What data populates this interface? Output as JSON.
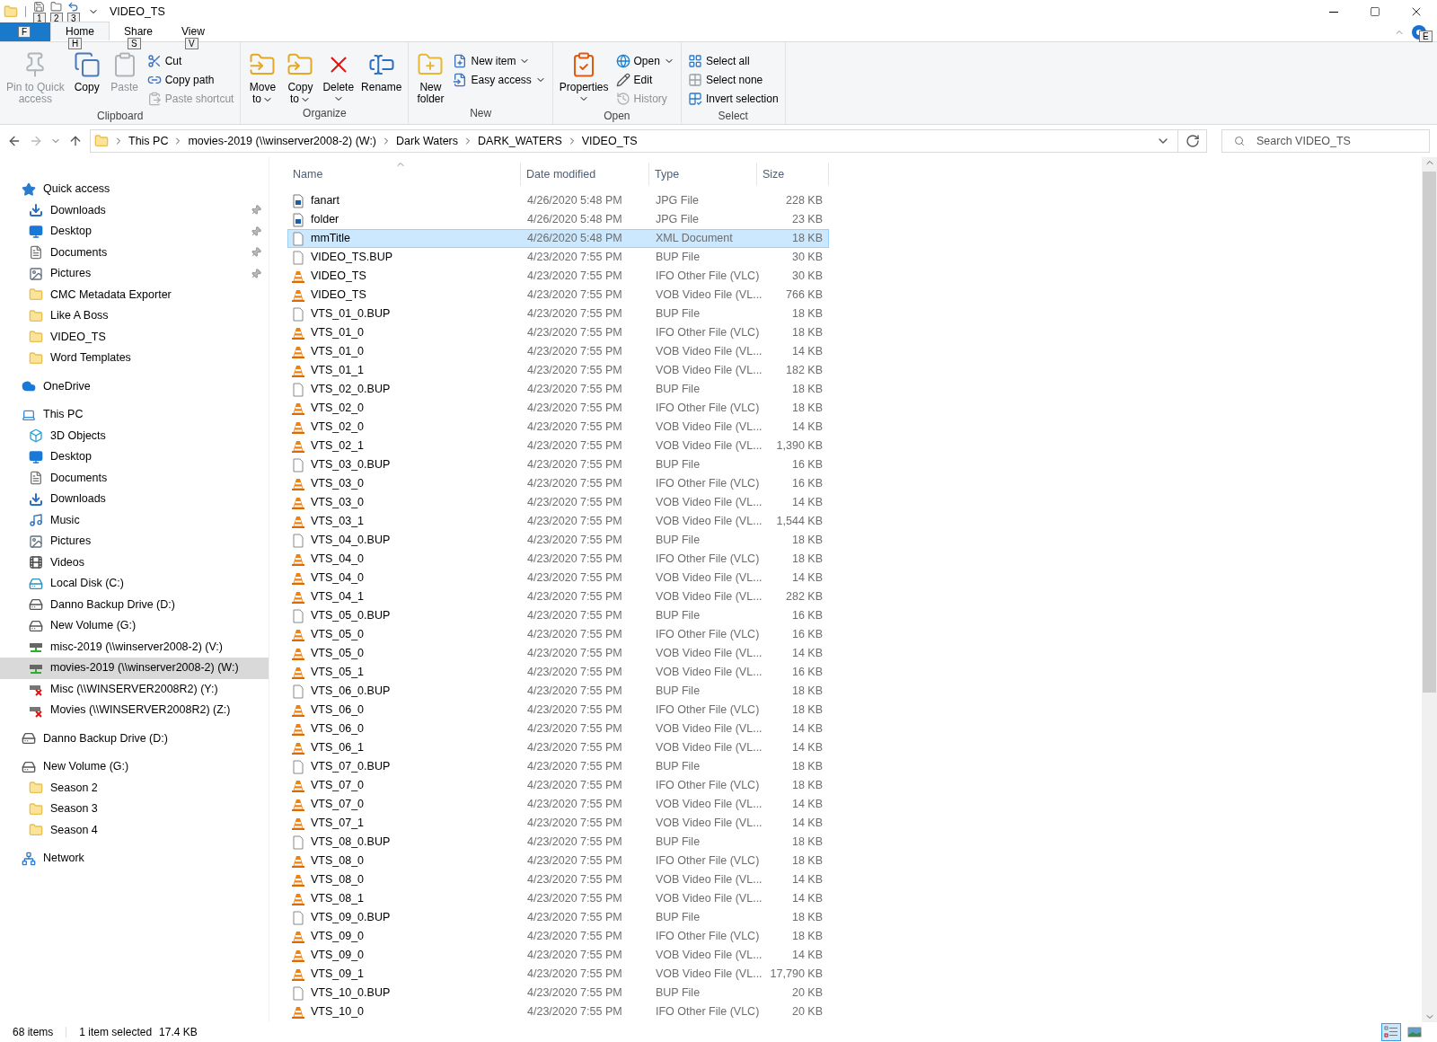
{
  "window": {
    "title": "VIDEO_TS"
  },
  "quick_access_toolbar": [
    {
      "key_tip": "1"
    },
    {
      "key_tip": "2"
    },
    {
      "key_tip": "3"
    }
  ],
  "tabs": [
    {
      "kind": "file",
      "key_tip": "F",
      "selected": false
    },
    {
      "kind": "tab",
      "label": "Home",
      "key_tip": "H",
      "selected": true
    },
    {
      "kind": "tab",
      "label": "Share",
      "key_tip": "S",
      "selected": false
    },
    {
      "kind": "tab",
      "label": "View",
      "key_tip": "V",
      "selected": false
    }
  ],
  "help": {
    "key_tip": "E"
  },
  "ribbon": [
    {
      "label": "Clipboard",
      "items": [
        {
          "kind": "large",
          "lines": [
            "Pin to Quick",
            "access"
          ],
          "disabled": true,
          "dropdown": false
        },
        {
          "kind": "large",
          "lines": [
            "Copy"
          ],
          "disabled": false,
          "dropdown": false
        },
        {
          "kind": "large",
          "lines": [
            "Paste"
          ],
          "disabled": true,
          "dropdown": false
        },
        {
          "kind": "small",
          "lines": [
            "Cut"
          ],
          "disabled": false,
          "dropdown": false
        },
        {
          "kind": "small",
          "lines": [
            "Copy path"
          ],
          "disabled": false,
          "dropdown": false
        },
        {
          "kind": "small",
          "lines": [
            "Paste shortcut"
          ],
          "disabled": true,
          "dropdown": false
        }
      ]
    },
    {
      "label": "Organize",
      "items": [
        {
          "kind": "large",
          "lines": [
            "Move",
            "to"
          ],
          "disabled": false,
          "dropdown": true
        },
        {
          "kind": "large",
          "lines": [
            "Copy",
            "to"
          ],
          "disabled": false,
          "dropdown": true
        },
        {
          "kind": "large",
          "lines": [
            "Delete"
          ],
          "disabled": false,
          "dropdown": true
        },
        {
          "kind": "large",
          "lines": [
            "Rename"
          ],
          "disabled": false,
          "dropdown": false
        }
      ]
    },
    {
      "label": "New",
      "items": [
        {
          "kind": "large",
          "lines": [
            "New",
            "folder"
          ],
          "disabled": false,
          "dropdown": false
        },
        {
          "kind": "small",
          "lines": [
            "New item"
          ],
          "disabled": false,
          "dropdown": true
        },
        {
          "kind": "small",
          "lines": [
            "Easy access"
          ],
          "disabled": false,
          "dropdown": true
        }
      ]
    },
    {
      "label": "Open",
      "items": [
        {
          "kind": "large",
          "lines": [
            "Properties"
          ],
          "disabled": false,
          "dropdown": true
        },
        {
          "kind": "small",
          "lines": [
            "Open"
          ],
          "disabled": false,
          "dropdown": true
        },
        {
          "kind": "small",
          "lines": [
            "Edit"
          ],
          "disabled": false,
          "dropdown": false
        },
        {
          "kind": "small",
          "lines": [
            "History"
          ],
          "disabled": true,
          "dropdown": false
        }
      ]
    },
    {
      "label": "Select",
      "items": [
        {
          "kind": "small",
          "lines": [
            "Select all"
          ],
          "disabled": false,
          "dropdown": false
        },
        {
          "kind": "small",
          "lines": [
            "Select none"
          ],
          "disabled": false,
          "dropdown": false
        },
        {
          "kind": "small",
          "lines": [
            "Invert selection"
          ],
          "disabled": false,
          "dropdown": false
        }
      ]
    }
  ],
  "address_bar": {
    "breadcrumbs": [
      "This PC",
      "movies-2019 (\\\\winserver2008-2) (W:)",
      "Dark Waters",
      "DARK_WATERS",
      "VIDEO_TS"
    ]
  },
  "search": {
    "placeholder": "Search VIDEO_TS"
  },
  "navigation": [
    {
      "label": "Quick access",
      "kind": "star",
      "selected": false,
      "children": [
        {
          "label": "Downloads",
          "kind": "download",
          "selected": false,
          "pinned": true
        },
        {
          "label": "Desktop",
          "kind": "desktop",
          "selected": false,
          "pinned": true
        },
        {
          "label": "Documents",
          "kind": "documents",
          "selected": false,
          "pinned": true
        },
        {
          "label": "Pictures",
          "kind": "pictures",
          "selected": false,
          "pinned": true
        },
        {
          "label": "CMC Metadata Exporter",
          "kind": "folder",
          "selected": false,
          "pinned": false
        },
        {
          "label": "Like A Boss",
          "kind": "folder",
          "selected": false,
          "pinned": false
        },
        {
          "label": "VIDEO_TS",
          "kind": "folder",
          "selected": false,
          "pinned": false
        },
        {
          "label": "Word Templates",
          "kind": "folder",
          "selected": false,
          "pinned": false
        }
      ]
    },
    {
      "label": "OneDrive",
      "kind": "cloud",
      "selected": false
    },
    {
      "label": "This PC",
      "kind": "pc",
      "selected": false,
      "children": [
        {
          "label": "3D Objects",
          "kind": "cube",
          "selected": false
        },
        {
          "label": "Desktop",
          "kind": "desktop",
          "selected": false
        },
        {
          "label": "Documents",
          "kind": "documents",
          "selected": false
        },
        {
          "label": "Downloads",
          "kind": "download",
          "selected": false
        },
        {
          "label": "Music",
          "kind": "music",
          "selected": false
        },
        {
          "label": "Pictures",
          "kind": "pictures",
          "selected": false
        },
        {
          "label": "Videos",
          "kind": "videos",
          "selected": false
        },
        {
          "label": "Local Disk (C:)",
          "kind": "system_disk",
          "selected": false
        },
        {
          "label": "Danno Backup Drive (D:)",
          "kind": "disk",
          "selected": false
        },
        {
          "label": "New Volume (G:)",
          "kind": "disk",
          "selected": false
        },
        {
          "label": "misc-2019 (\\\\winserver2008-2) (V:)",
          "kind": "net_drive",
          "selected": false
        },
        {
          "label": "movies-2019 (\\\\winserver2008-2) (W:)",
          "kind": "net_drive",
          "selected": true
        },
        {
          "label": "Misc (\\\\WINSERVER2008R2) (Y:)",
          "kind": "net_drive_off",
          "selected": false
        },
        {
          "label": "Movies (\\\\WINSERVER2008R2) (Z:)",
          "kind": "net_drive_off",
          "selected": false
        }
      ]
    },
    {
      "label": "Danno Backup Drive (D:)",
      "kind": "disk",
      "selected": false
    },
    {
      "label": "New Volume (G:)",
      "kind": "disk",
      "selected": false,
      "children": [
        {
          "label": "Season 2",
          "kind": "folder",
          "selected": false
        },
        {
          "label": "Season 3",
          "kind": "folder",
          "selected": false
        },
        {
          "label": "Season 4",
          "kind": "folder",
          "selected": false
        }
      ]
    },
    {
      "label": "Network",
      "kind": "network",
      "selected": false
    }
  ],
  "file_list": {
    "columns": [
      "Name",
      "Date modified",
      "Type",
      "Size"
    ],
    "rows": [
      {
        "name": "fanart",
        "date": "4/26/2020 5:48 PM",
        "type": "JPG File",
        "size": "228 KB",
        "kind": "image",
        "selected": false
      },
      {
        "name": "folder",
        "date": "4/26/2020 5:48 PM",
        "type": "JPG File",
        "size": "23 KB",
        "kind": "image",
        "selected": false
      },
      {
        "name": "mmTitle",
        "date": "4/26/2020 5:48 PM",
        "type": "XML Document",
        "size": "18 KB",
        "kind": "blank",
        "selected": true
      },
      {
        "name": "VIDEO_TS.BUP",
        "date": "4/23/2020 7:55 PM",
        "type": "BUP File",
        "size": "30 KB",
        "kind": "blank",
        "selected": false
      },
      {
        "name": "VIDEO_TS",
        "date": "4/23/2020 7:55 PM",
        "type": "IFO Other File (VLC)",
        "size": "30 KB",
        "kind": "vlc",
        "selected": false
      },
      {
        "name": "VIDEO_TS",
        "date": "4/23/2020 7:55 PM",
        "type": "VOB Video File (VL...",
        "size": "766 KB",
        "kind": "vlc",
        "selected": false
      },
      {
        "name": "VTS_01_0.BUP",
        "date": "4/23/2020 7:55 PM",
        "type": "BUP File",
        "size": "18 KB",
        "kind": "blank",
        "selected": false
      },
      {
        "name": "VTS_01_0",
        "date": "4/23/2020 7:55 PM",
        "type": "IFO Other File (VLC)",
        "size": "18 KB",
        "kind": "vlc",
        "selected": false
      },
      {
        "name": "VTS_01_0",
        "date": "4/23/2020 7:55 PM",
        "type": "VOB Video File (VL...",
        "size": "14 KB",
        "kind": "vlc",
        "selected": false
      },
      {
        "name": "VTS_01_1",
        "date": "4/23/2020 7:55 PM",
        "type": "VOB Video File (VL...",
        "size": "182 KB",
        "kind": "vlc",
        "selected": false
      },
      {
        "name": "VTS_02_0.BUP",
        "date": "4/23/2020 7:55 PM",
        "type": "BUP File",
        "size": "18 KB",
        "kind": "blank",
        "selected": false
      },
      {
        "name": "VTS_02_0",
        "date": "4/23/2020 7:55 PM",
        "type": "IFO Other File (VLC)",
        "size": "18 KB",
        "kind": "vlc",
        "selected": false
      },
      {
        "name": "VTS_02_0",
        "date": "4/23/2020 7:55 PM",
        "type": "VOB Video File (VL...",
        "size": "14 KB",
        "kind": "vlc",
        "selected": false
      },
      {
        "name": "VTS_02_1",
        "date": "4/23/2020 7:55 PM",
        "type": "VOB Video File (VL...",
        "size": "1,390 KB",
        "kind": "vlc",
        "selected": false
      },
      {
        "name": "VTS_03_0.BUP",
        "date": "4/23/2020 7:55 PM",
        "type": "BUP File",
        "size": "16 KB",
        "kind": "blank",
        "selected": false
      },
      {
        "name": "VTS_03_0",
        "date": "4/23/2020 7:55 PM",
        "type": "IFO Other File (VLC)",
        "size": "16 KB",
        "kind": "vlc",
        "selected": false
      },
      {
        "name": "VTS_03_0",
        "date": "4/23/2020 7:55 PM",
        "type": "VOB Video File (VL...",
        "size": "14 KB",
        "kind": "vlc",
        "selected": false
      },
      {
        "name": "VTS_03_1",
        "date": "4/23/2020 7:55 PM",
        "type": "VOB Video File (VL...",
        "size": "1,544 KB",
        "kind": "vlc",
        "selected": false
      },
      {
        "name": "VTS_04_0.BUP",
        "date": "4/23/2020 7:55 PM",
        "type": "BUP File",
        "size": "18 KB",
        "kind": "blank",
        "selected": false
      },
      {
        "name": "VTS_04_0",
        "date": "4/23/2020 7:55 PM",
        "type": "IFO Other File (VLC)",
        "size": "18 KB",
        "kind": "vlc",
        "selected": false
      },
      {
        "name": "VTS_04_0",
        "date": "4/23/2020 7:55 PM",
        "type": "VOB Video File (VL...",
        "size": "14 KB",
        "kind": "vlc",
        "selected": false
      },
      {
        "name": "VTS_04_1",
        "date": "4/23/2020 7:55 PM",
        "type": "VOB Video File (VL...",
        "size": "282 KB",
        "kind": "vlc",
        "selected": false
      },
      {
        "name": "VTS_05_0.BUP",
        "date": "4/23/2020 7:55 PM",
        "type": "BUP File",
        "size": "16 KB",
        "kind": "blank",
        "selected": false
      },
      {
        "name": "VTS_05_0",
        "date": "4/23/2020 7:55 PM",
        "type": "IFO Other File (VLC)",
        "size": "16 KB",
        "kind": "vlc",
        "selected": false
      },
      {
        "name": "VTS_05_0",
        "date": "4/23/2020 7:55 PM",
        "type": "VOB Video File (VL...",
        "size": "14 KB",
        "kind": "vlc",
        "selected": false
      },
      {
        "name": "VTS_05_1",
        "date": "4/23/2020 7:55 PM",
        "type": "VOB Video File (VL...",
        "size": "16 KB",
        "kind": "vlc",
        "selected": false
      },
      {
        "name": "VTS_06_0.BUP",
        "date": "4/23/2020 7:55 PM",
        "type": "BUP File",
        "size": "18 KB",
        "kind": "blank",
        "selected": false
      },
      {
        "name": "VTS_06_0",
        "date": "4/23/2020 7:55 PM",
        "type": "IFO Other File (VLC)",
        "size": "18 KB",
        "kind": "vlc",
        "selected": false
      },
      {
        "name": "VTS_06_0",
        "date": "4/23/2020 7:55 PM",
        "type": "VOB Video File (VL...",
        "size": "14 KB",
        "kind": "vlc",
        "selected": false
      },
      {
        "name": "VTS_06_1",
        "date": "4/23/2020 7:55 PM",
        "type": "VOB Video File (VL...",
        "size": "14 KB",
        "kind": "vlc",
        "selected": false
      },
      {
        "name": "VTS_07_0.BUP",
        "date": "4/23/2020 7:55 PM",
        "type": "BUP File",
        "size": "18 KB",
        "kind": "blank",
        "selected": false
      },
      {
        "name": "VTS_07_0",
        "date": "4/23/2020 7:55 PM",
        "type": "IFO Other File (VLC)",
        "size": "18 KB",
        "kind": "vlc",
        "selected": false
      },
      {
        "name": "VTS_07_0",
        "date": "4/23/2020 7:55 PM",
        "type": "VOB Video File (VL...",
        "size": "14 KB",
        "kind": "vlc",
        "selected": false
      },
      {
        "name": "VTS_07_1",
        "date": "4/23/2020 7:55 PM",
        "type": "VOB Video File (VL...",
        "size": "14 KB",
        "kind": "vlc",
        "selected": false
      },
      {
        "name": "VTS_08_0.BUP",
        "date": "4/23/2020 7:55 PM",
        "type": "BUP File",
        "size": "18 KB",
        "kind": "blank",
        "selected": false
      },
      {
        "name": "VTS_08_0",
        "date": "4/23/2020 7:55 PM",
        "type": "IFO Other File (VLC)",
        "size": "18 KB",
        "kind": "vlc",
        "selected": false
      },
      {
        "name": "VTS_08_0",
        "date": "4/23/2020 7:55 PM",
        "type": "VOB Video File (VL...",
        "size": "14 KB",
        "kind": "vlc",
        "selected": false
      },
      {
        "name": "VTS_08_1",
        "date": "4/23/2020 7:55 PM",
        "type": "VOB Video File (VL...",
        "size": "14 KB",
        "kind": "vlc",
        "selected": false
      },
      {
        "name": "VTS_09_0.BUP",
        "date": "4/23/2020 7:55 PM",
        "type": "BUP File",
        "size": "18 KB",
        "kind": "blank",
        "selected": false
      },
      {
        "name": "VTS_09_0",
        "date": "4/23/2020 7:55 PM",
        "type": "IFO Other File (VLC)",
        "size": "18 KB",
        "kind": "vlc",
        "selected": false
      },
      {
        "name": "VTS_09_0",
        "date": "4/23/2020 7:55 PM",
        "type": "VOB Video File (VL...",
        "size": "14 KB",
        "kind": "vlc",
        "selected": false
      },
      {
        "name": "VTS_09_1",
        "date": "4/23/2020 7:55 PM",
        "type": "VOB Video File (VL...",
        "size": "17,790 KB",
        "kind": "vlc",
        "selected": false
      },
      {
        "name": "VTS_10_0.BUP",
        "date": "4/23/2020 7:55 PM",
        "type": "BUP File",
        "size": "20 KB",
        "kind": "blank",
        "selected": false
      },
      {
        "name": "VTS_10_0",
        "date": "4/23/2020 7:55 PM",
        "type": "IFO Other File (VLC)",
        "size": "20 KB",
        "kind": "vlc",
        "selected": false
      }
    ]
  },
  "status_bar": {
    "item_count": "68 items",
    "selection": "1 item selected",
    "selection_size": "17.4 KB"
  },
  "view_buttons": [
    {
      "kind": "details",
      "selected": true
    },
    {
      "kind": "large_icons",
      "selected": false
    }
  ]
}
